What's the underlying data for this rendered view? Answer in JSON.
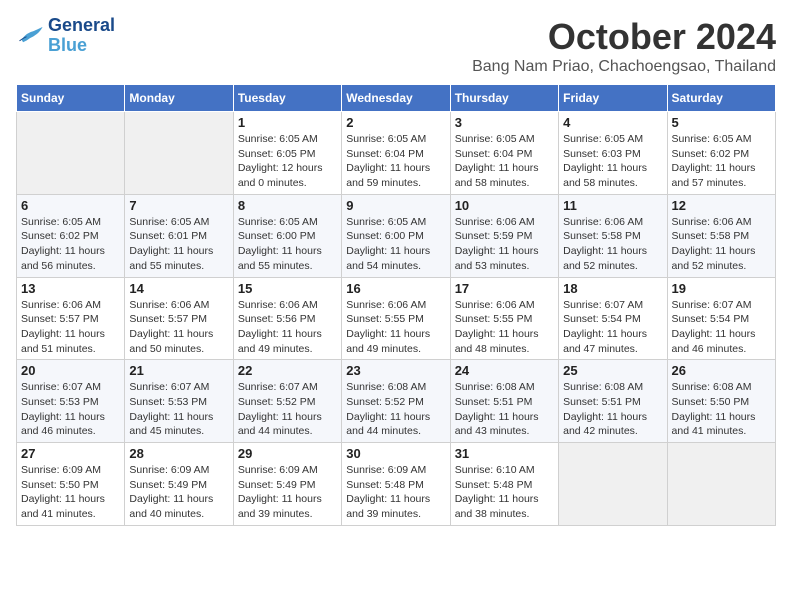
{
  "header": {
    "logo_line1": "General",
    "logo_line2": "Blue",
    "month": "October 2024",
    "location": "Bang Nam Priao, Chachoengsao, Thailand"
  },
  "days_of_week": [
    "Sunday",
    "Monday",
    "Tuesday",
    "Wednesday",
    "Thursday",
    "Friday",
    "Saturday"
  ],
  "weeks": [
    [
      {
        "day": "",
        "info": ""
      },
      {
        "day": "",
        "info": ""
      },
      {
        "day": "1",
        "info": "Sunrise: 6:05 AM\nSunset: 6:05 PM\nDaylight: 12 hours\nand 0 minutes."
      },
      {
        "day": "2",
        "info": "Sunrise: 6:05 AM\nSunset: 6:04 PM\nDaylight: 11 hours\nand 59 minutes."
      },
      {
        "day": "3",
        "info": "Sunrise: 6:05 AM\nSunset: 6:04 PM\nDaylight: 11 hours\nand 58 minutes."
      },
      {
        "day": "4",
        "info": "Sunrise: 6:05 AM\nSunset: 6:03 PM\nDaylight: 11 hours\nand 58 minutes."
      },
      {
        "day": "5",
        "info": "Sunrise: 6:05 AM\nSunset: 6:02 PM\nDaylight: 11 hours\nand 57 minutes."
      }
    ],
    [
      {
        "day": "6",
        "info": "Sunrise: 6:05 AM\nSunset: 6:02 PM\nDaylight: 11 hours\nand 56 minutes."
      },
      {
        "day": "7",
        "info": "Sunrise: 6:05 AM\nSunset: 6:01 PM\nDaylight: 11 hours\nand 55 minutes."
      },
      {
        "day": "8",
        "info": "Sunrise: 6:05 AM\nSunset: 6:00 PM\nDaylight: 11 hours\nand 55 minutes."
      },
      {
        "day": "9",
        "info": "Sunrise: 6:05 AM\nSunset: 6:00 PM\nDaylight: 11 hours\nand 54 minutes."
      },
      {
        "day": "10",
        "info": "Sunrise: 6:06 AM\nSunset: 5:59 PM\nDaylight: 11 hours\nand 53 minutes."
      },
      {
        "day": "11",
        "info": "Sunrise: 6:06 AM\nSunset: 5:58 PM\nDaylight: 11 hours\nand 52 minutes."
      },
      {
        "day": "12",
        "info": "Sunrise: 6:06 AM\nSunset: 5:58 PM\nDaylight: 11 hours\nand 52 minutes."
      }
    ],
    [
      {
        "day": "13",
        "info": "Sunrise: 6:06 AM\nSunset: 5:57 PM\nDaylight: 11 hours\nand 51 minutes."
      },
      {
        "day": "14",
        "info": "Sunrise: 6:06 AM\nSunset: 5:57 PM\nDaylight: 11 hours\nand 50 minutes."
      },
      {
        "day": "15",
        "info": "Sunrise: 6:06 AM\nSunset: 5:56 PM\nDaylight: 11 hours\nand 49 minutes."
      },
      {
        "day": "16",
        "info": "Sunrise: 6:06 AM\nSunset: 5:55 PM\nDaylight: 11 hours\nand 49 minutes."
      },
      {
        "day": "17",
        "info": "Sunrise: 6:06 AM\nSunset: 5:55 PM\nDaylight: 11 hours\nand 48 minutes."
      },
      {
        "day": "18",
        "info": "Sunrise: 6:07 AM\nSunset: 5:54 PM\nDaylight: 11 hours\nand 47 minutes."
      },
      {
        "day": "19",
        "info": "Sunrise: 6:07 AM\nSunset: 5:54 PM\nDaylight: 11 hours\nand 46 minutes."
      }
    ],
    [
      {
        "day": "20",
        "info": "Sunrise: 6:07 AM\nSunset: 5:53 PM\nDaylight: 11 hours\nand 46 minutes."
      },
      {
        "day": "21",
        "info": "Sunrise: 6:07 AM\nSunset: 5:53 PM\nDaylight: 11 hours\nand 45 minutes."
      },
      {
        "day": "22",
        "info": "Sunrise: 6:07 AM\nSunset: 5:52 PM\nDaylight: 11 hours\nand 44 minutes."
      },
      {
        "day": "23",
        "info": "Sunrise: 6:08 AM\nSunset: 5:52 PM\nDaylight: 11 hours\nand 44 minutes."
      },
      {
        "day": "24",
        "info": "Sunrise: 6:08 AM\nSunset: 5:51 PM\nDaylight: 11 hours\nand 43 minutes."
      },
      {
        "day": "25",
        "info": "Sunrise: 6:08 AM\nSunset: 5:51 PM\nDaylight: 11 hours\nand 42 minutes."
      },
      {
        "day": "26",
        "info": "Sunrise: 6:08 AM\nSunset: 5:50 PM\nDaylight: 11 hours\nand 41 minutes."
      }
    ],
    [
      {
        "day": "27",
        "info": "Sunrise: 6:09 AM\nSunset: 5:50 PM\nDaylight: 11 hours\nand 41 minutes."
      },
      {
        "day": "28",
        "info": "Sunrise: 6:09 AM\nSunset: 5:49 PM\nDaylight: 11 hours\nand 40 minutes."
      },
      {
        "day": "29",
        "info": "Sunrise: 6:09 AM\nSunset: 5:49 PM\nDaylight: 11 hours\nand 39 minutes."
      },
      {
        "day": "30",
        "info": "Sunrise: 6:09 AM\nSunset: 5:48 PM\nDaylight: 11 hours\nand 39 minutes."
      },
      {
        "day": "31",
        "info": "Sunrise: 6:10 AM\nSunset: 5:48 PM\nDaylight: 11 hours\nand 38 minutes."
      },
      {
        "day": "",
        "info": ""
      },
      {
        "day": "",
        "info": ""
      }
    ]
  ]
}
